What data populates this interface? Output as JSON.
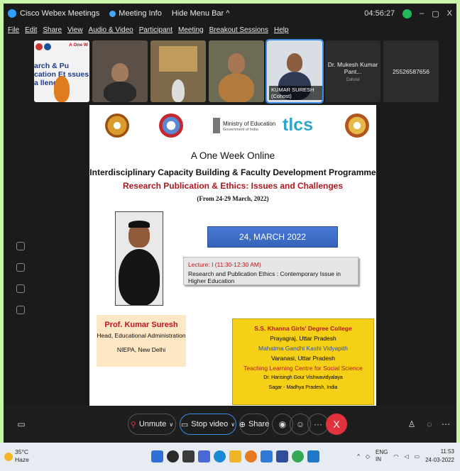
{
  "titlebar": {
    "app_name": "Cisco Webex Meetings",
    "meeting_info": "Meeting Info",
    "hide_menu": "Hide Menu Bar ^",
    "timer": "04:56:27",
    "minimize": "–",
    "restore": "▢",
    "close": "X"
  },
  "menubar": [
    "File",
    "Edit",
    "Share",
    "View",
    "Audio & Video",
    "Participant",
    "Meeting",
    "Breakout Sessions",
    "Help"
  ],
  "participants": {
    "tile1_text": "A One W",
    "tile1_overlay": "arch & Pu cation Et ssues a llenges",
    "tile5_label": "KUMAR SURESH (Cohost)",
    "tile6_name": "Dr. Mukesh Kumar Pant...",
    "tile6_role": "Cohost",
    "tile7_name": "25526587656"
  },
  "slide": {
    "ministry": "Ministry of Education",
    "ministry_sub": "Government of India",
    "tlcs": "tlcs",
    "title1": "A One Week Online",
    "title2": "Interdisciplinary Capacity Building & Faculty Development Programme",
    "title3": "Research Publication & Ethics: Issues and Challenges",
    "title4": "(From 24-29 March, 2022)",
    "date": "24, MARCH 2022",
    "lecture_line1": "Lecture: I (11:30-12:30 AM)",
    "lecture_line2": "Research and Publication Ethics : Contemporary Issue in Higher Education",
    "prof_name": "Prof. Kumar Suresh",
    "prof_title": "Head, Educational Administration",
    "prof_org": "NIEPA, New Delhi",
    "college": [
      "S.S. Khanna Girls' Degree College",
      "Prayagraj, Uttar Pradesh",
      "Mahatma Gandhi Kashi Vidyapith",
      "Varanasi, Uttar Pradesh",
      "Teaching Learning Centre for Social Science",
      "Dr. Harisingh Gour Vishwavidyalaya",
      "Sagar - Madhya Pradesh, India"
    ]
  },
  "controls": {
    "unmute": "Unmute",
    "stop_video": "Stop video",
    "share": "Share",
    "more": "···",
    "leave": "X"
  },
  "taskbar": {
    "temp": "35°C",
    "weather": "Haze",
    "lang1": "ENG",
    "lang2": "IN",
    "time": "11:53",
    "date": "24-03-2022"
  },
  "colors": {
    "accent_blue": "#3a8ee6",
    "leave_red": "#e2323e",
    "slide_red": "#b0171f",
    "college_yellow": "#f6d017",
    "border_green": "#c8f5a8"
  }
}
